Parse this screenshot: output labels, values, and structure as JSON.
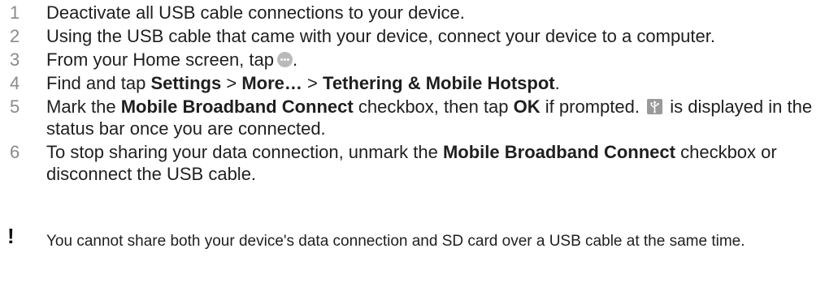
{
  "steps": [
    {
      "num": "1",
      "text": "Deactivate all USB cable connections to your device."
    },
    {
      "num": "2",
      "text": "Using the USB cable that came with your device, connect your device to a computer."
    },
    {
      "num": "3",
      "text_before": "From your Home screen, tap",
      "icon": "apps-icon",
      "text_after": "."
    },
    {
      "num": "4",
      "text": "Find and tap",
      "b1": "Settings",
      "sep1": ">",
      "b2": "More…",
      "sep2": ">",
      "b3": "Tethering & Mobile Hotspot",
      "end": "."
    },
    {
      "num": "5",
      "t1": "Mark the",
      "b1": "Mobile Broadband Connect",
      "t2": "checkbox, then tap",
      "b2": "OK",
      "t3": "if prompted.",
      "icon": "usb-tethering-icon",
      "t4": "is displayed in the status bar once you are connected."
    },
    {
      "num": "6",
      "t1": "To stop sharing your data connection, unmark the",
      "b1": "Mobile Broadband Connect",
      "t2": "checkbox or disconnect the USB cable."
    }
  ],
  "note": {
    "icon": "exclamation-icon",
    "text": "You cannot share both your device's data connection and SD card over a USB cable at the same time."
  }
}
